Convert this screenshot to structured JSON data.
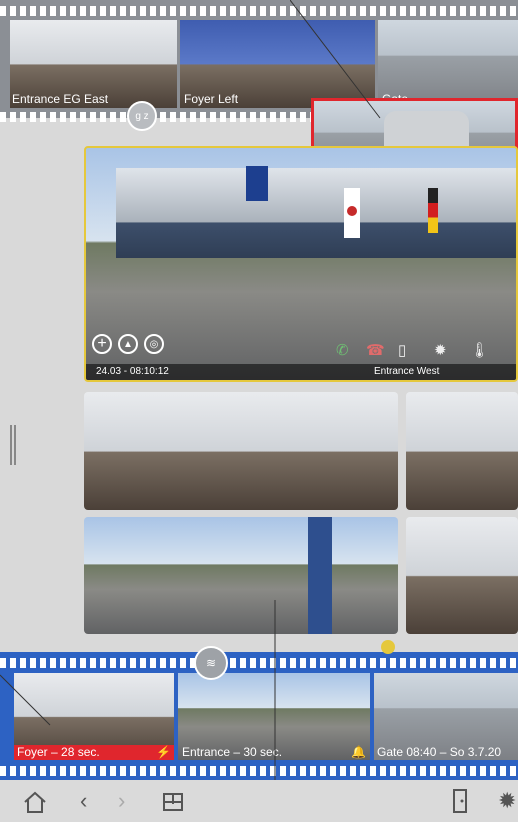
{
  "top_strip": {
    "thumbs": [
      {
        "label": "Entrance EG East"
      },
      {
        "label": "Foyer Left"
      },
      {
        "label": "Gate"
      }
    ],
    "sort_button": "g z"
  },
  "main_view": {
    "timestamp": "24.03 - 08:10:12",
    "camera_name": "Entrance West"
  },
  "bottom_strip": {
    "thumbs": [
      {
        "label": "Foyer – 28 sec."
      },
      {
        "label": "Entrance – 30 sec."
      },
      {
        "label": "Gate 08:40 – So 3.7.20"
      }
    ]
  },
  "colors": {
    "accent_red": "#e0262d",
    "strip_blue": "#2d62c3",
    "highlight_yellow": "#e5c83c"
  },
  "icons": {
    "toolbar": [
      "home-icon",
      "chevron-left-icon",
      "chevron-right-icon",
      "layout-icon",
      "door-icon",
      "light-icon"
    ]
  }
}
